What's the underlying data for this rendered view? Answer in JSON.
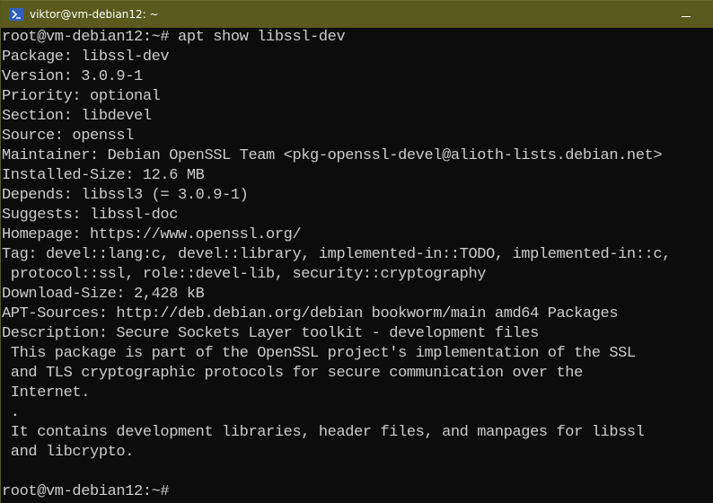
{
  "window": {
    "title": "viktor@vm-debian12: ~",
    "icon": "powershell-terminal-icon",
    "controls": {
      "minimize": "minimize"
    },
    "titlebar_color": "#5a5a1f",
    "background_color": "#0c0c0c",
    "text_color": "#cccccc"
  },
  "terminal": {
    "lines": [
      "root@vm-debian12:~# apt show libssl-dev",
      "Package: libssl-dev",
      "Version: 3.0.9-1",
      "Priority: optional",
      "Section: libdevel",
      "Source: openssl",
      "Maintainer: Debian OpenSSL Team <pkg-openssl-devel@alioth-lists.debian.net>",
      "Installed-Size: 12.6 MB",
      "Depends: libssl3 (= 3.0.9-1)",
      "Suggests: libssl-doc",
      "Homepage: https://www.openssl.org/",
      "Tag: devel::lang:c, devel::library, implemented-in::TODO, implemented-in::c,",
      " protocol::ssl, role::devel-lib, security::cryptography",
      "Download-Size: 2,428 kB",
      "APT-Sources: http://deb.debian.org/debian bookworm/main amd64 Packages",
      "Description: Secure Sockets Layer toolkit - development files",
      " This package is part of the OpenSSL project's implementation of the SSL",
      " and TLS cryptographic protocols for secure communication over the",
      " Internet.",
      " .",
      " It contains development libraries, header files, and manpages for libssl",
      " and libcrypto.",
      "",
      "root@vm-debian12:~#"
    ]
  }
}
